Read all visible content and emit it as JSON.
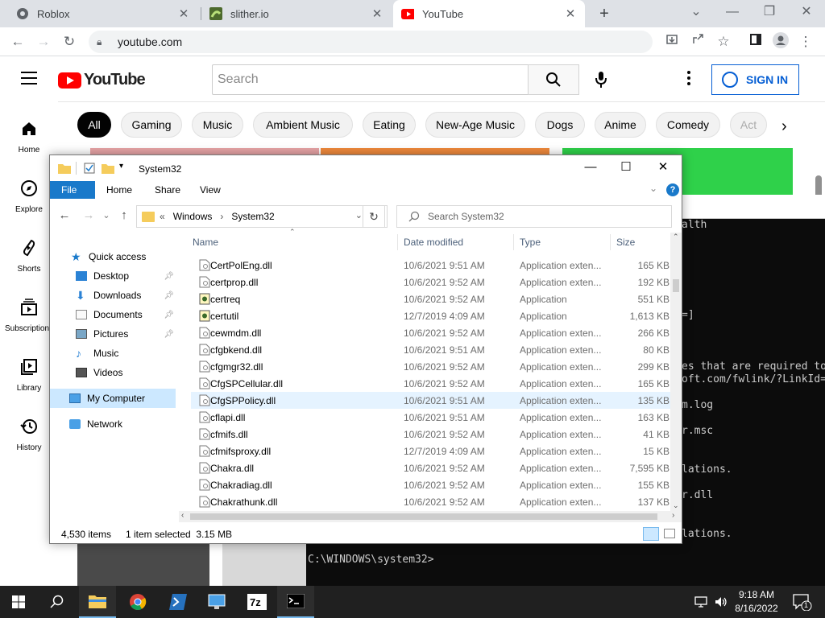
{
  "browser": {
    "tabs": [
      {
        "title": "Roblox",
        "active": false
      },
      {
        "title": "slither.io",
        "active": false
      },
      {
        "title": "YouTube",
        "active": true
      }
    ],
    "new_tab_glyph": "+",
    "url": "youtube.com"
  },
  "youtube": {
    "logo_text": "YouTube",
    "search_placeholder": "Search",
    "sign_in_label": "SIGN IN",
    "chips": [
      "All",
      "Gaming",
      "Music",
      "Ambient Music",
      "Eating",
      "New-Age Music",
      "Dogs",
      "Anime",
      "Comedy",
      "Act"
    ],
    "guide": [
      "Home",
      "Explore",
      "Shorts",
      "Subscriptions",
      "Library",
      "History"
    ],
    "brand_color": "#ff0000",
    "link_color": "#065fd4"
  },
  "terminal": {
    "lines": [
      {
        "text": "alth"
      },
      {
        "text": "=]"
      },
      {
        "text": "es that are required to"
      },
      {
        "text": "oft.com/fwlink/?LinkId="
      },
      {
        "text": "m.log"
      },
      {
        "text": "r.msc"
      },
      {
        "text": "lations."
      },
      {
        "text": "r.dll"
      },
      {
        "text": "lations."
      },
      {
        "text": "C:\\WINDOWS\\system32>"
      }
    ]
  },
  "explorer": {
    "title": "System32",
    "ribbon_tabs": [
      "File",
      "Home",
      "Share",
      "View"
    ],
    "breadcrumb": [
      "Windows",
      "System32"
    ],
    "breadcrumb_prefix": "«",
    "search_placeholder": "Search System32",
    "nav": {
      "quick_access": "Quick access",
      "items": [
        "Desktop",
        "Downloads",
        "Documents",
        "Pictures",
        "Music",
        "Videos"
      ],
      "my_computer": "My Computer",
      "network": "Network"
    },
    "columns": {
      "name": "Name",
      "date": "Date modified",
      "type": "Type",
      "size": "Size"
    },
    "files": [
      {
        "name": "CertPolEng.dll",
        "date": "10/6/2021 9:51 AM",
        "type": "Application exten...",
        "size": "165 KB",
        "kind": "dll"
      },
      {
        "name": "certprop.dll",
        "date": "10/6/2021 9:52 AM",
        "type": "Application exten...",
        "size": "192 KB",
        "kind": "dll"
      },
      {
        "name": "certreq",
        "date": "10/6/2021 9:52 AM",
        "type": "Application",
        "size": "551 KB",
        "kind": "exe"
      },
      {
        "name": "certutil",
        "date": "12/7/2019 4:09 AM",
        "type": "Application",
        "size": "1,613 KB",
        "kind": "exe"
      },
      {
        "name": "cewmdm.dll",
        "date": "10/6/2021 9:52 AM",
        "type": "Application exten...",
        "size": "266 KB",
        "kind": "dll"
      },
      {
        "name": "cfgbkend.dll",
        "date": "10/6/2021 9:51 AM",
        "type": "Application exten...",
        "size": "80 KB",
        "kind": "dll"
      },
      {
        "name": "cfgmgr32.dll",
        "date": "10/6/2021 9:52 AM",
        "type": "Application exten...",
        "size": "299 KB",
        "kind": "dll"
      },
      {
        "name": "CfgSPCellular.dll",
        "date": "10/6/2021 9:52 AM",
        "type": "Application exten...",
        "size": "165 KB",
        "kind": "dll"
      },
      {
        "name": "CfgSPPolicy.dll",
        "date": "10/6/2021 9:51 AM",
        "type": "Application exten...",
        "size": "135 KB",
        "kind": "dll",
        "selected": true
      },
      {
        "name": "cflapi.dll",
        "date": "10/6/2021 9:51 AM",
        "type": "Application exten...",
        "size": "163 KB",
        "kind": "dll"
      },
      {
        "name": "cfmifs.dll",
        "date": "10/6/2021 9:52 AM",
        "type": "Application exten...",
        "size": "41 KB",
        "kind": "dll"
      },
      {
        "name": "cfmifsproxy.dll",
        "date": "12/7/2019 4:09 AM",
        "type": "Application exten...",
        "size": "15 KB",
        "kind": "dll"
      },
      {
        "name": "Chakra.dll",
        "date": "10/6/2021 9:52 AM",
        "type": "Application exten...",
        "size": "7,595 KB",
        "kind": "dll"
      },
      {
        "name": "Chakradiag.dll",
        "date": "10/6/2021 9:52 AM",
        "type": "Application exten...",
        "size": "155 KB",
        "kind": "dll"
      },
      {
        "name": "Chakrathunk.dll",
        "date": "10/6/2021 9:52 AM",
        "type": "Application exten...",
        "size": "137 KB",
        "kind": "dll"
      }
    ],
    "status_count": "4,530 items",
    "status_selected": "1 item selected  3.15 MB",
    "accent_color": "#1979ca"
  },
  "taskbar": {
    "time": "9:18 AM",
    "date": "8/16/2022",
    "notification_count": "1"
  }
}
